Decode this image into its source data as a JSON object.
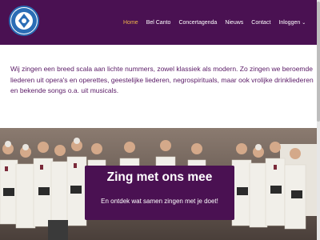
{
  "header": {
    "logo": {
      "text": "BEL CANTO",
      "icon": "logo-emblem"
    },
    "nav": [
      {
        "label": "Home",
        "active": true
      },
      {
        "label": "Bel Canto",
        "active": false
      },
      {
        "label": "Concertagenda",
        "active": false
      },
      {
        "label": "Nieuws",
        "active": false
      },
      {
        "label": "Contact",
        "active": false
      },
      {
        "label": "Inloggen",
        "active": false,
        "dropdown": true
      }
    ]
  },
  "intro": {
    "text": "Wij zingen een breed scala aan lichte nummers, zowel klassiek als modern. Zo zingen we beroemde liederen uit opera's en operettes, geestelijke liederen, negrospirituals, maar ook vrolijke drinkliederen en bekende songs o.a. uit musicals."
  },
  "hero": {
    "title": "Zing met ons mee",
    "subtitle": "En ontdek wat samen zingen met je doet!"
  },
  "colors": {
    "primary": "#4a1152",
    "active_nav": "#f0b44a",
    "text": "#5a1a66"
  }
}
